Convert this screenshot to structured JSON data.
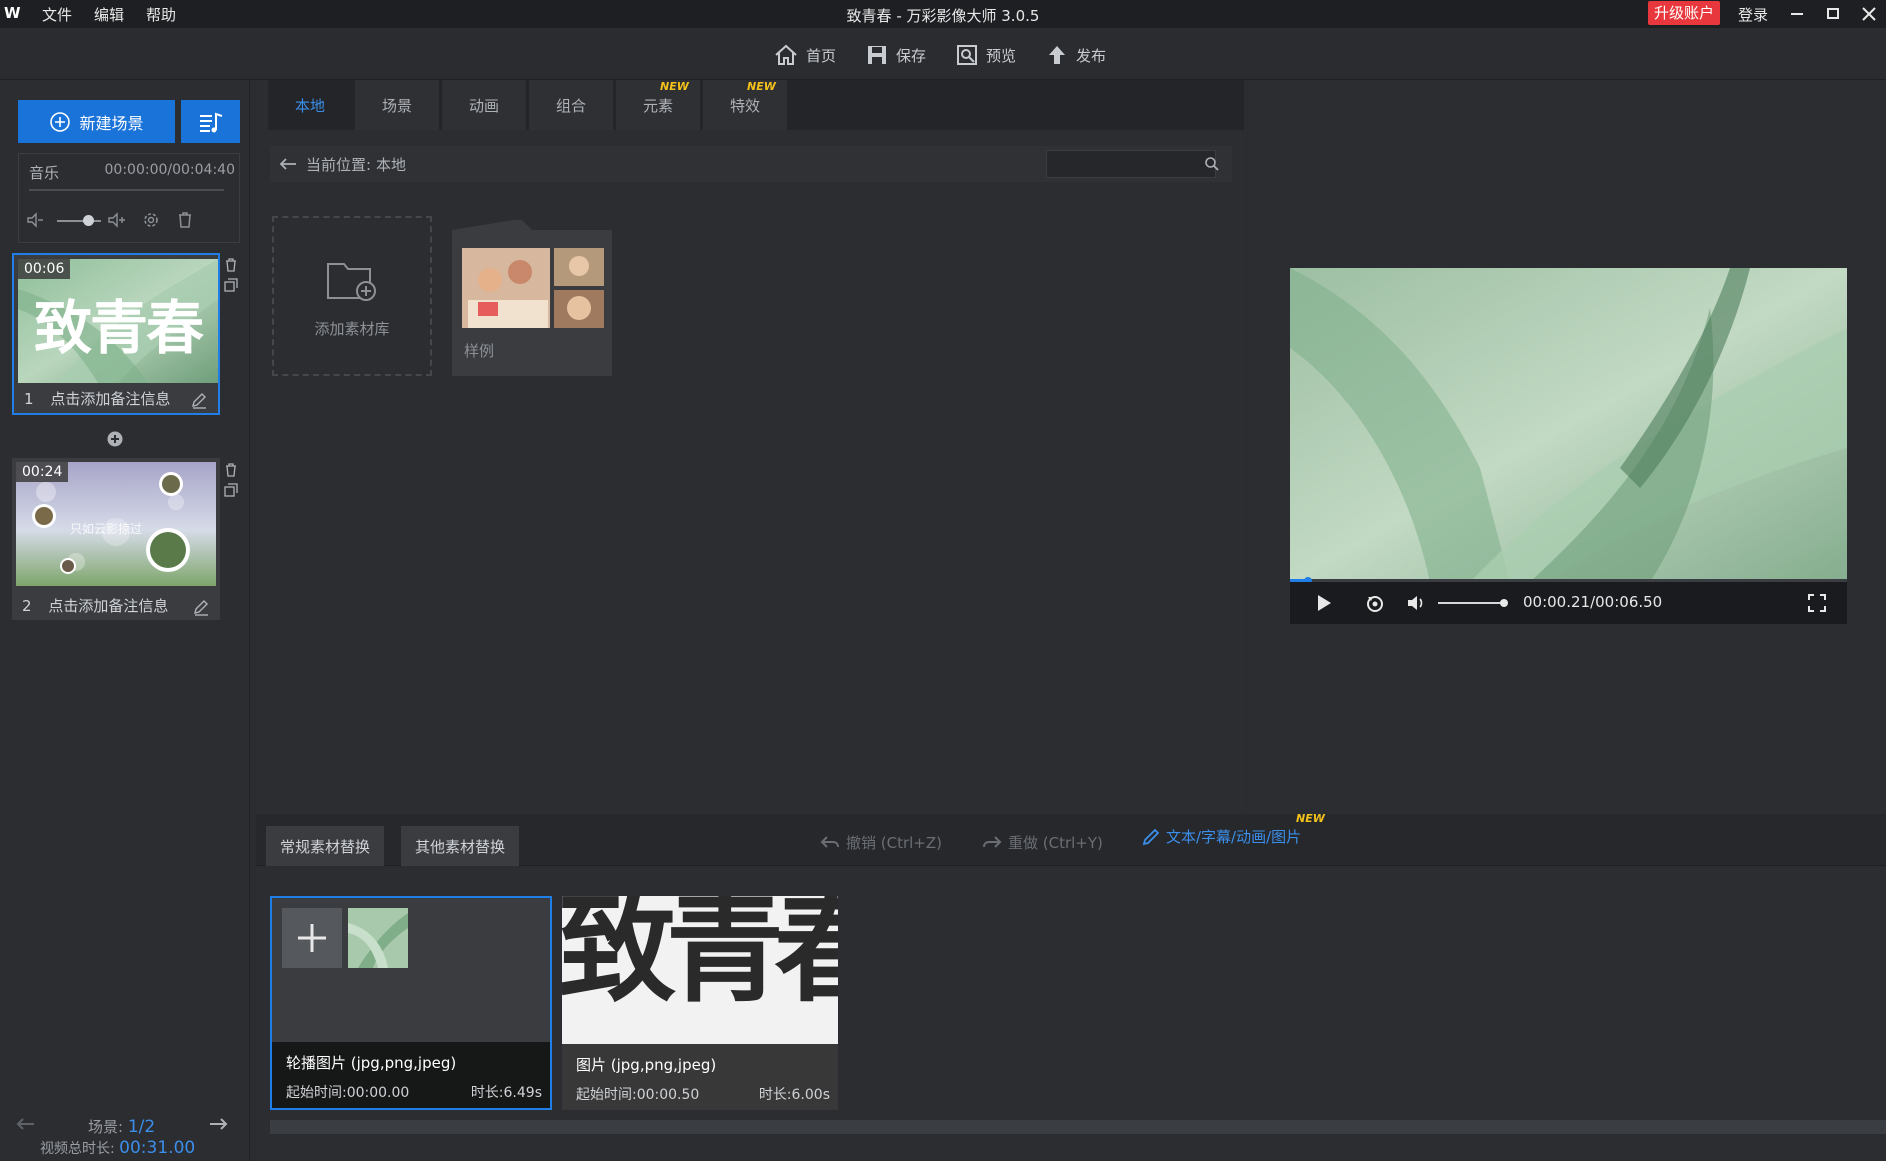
{
  "app": {
    "title": "致青春 - 万彩影像大师 3.0.5",
    "logo_text": "W",
    "menu": [
      "文件",
      "编辑",
      "帮助"
    ],
    "upgrade_label": "升级账户",
    "login_label": "登录"
  },
  "toolbar": {
    "home_label": "首页",
    "save_label": "保存",
    "preview_label": "预览",
    "publish_label": "发布"
  },
  "left": {
    "new_scene_label": "新建场景",
    "music_label": "音乐",
    "music_time": "00:00:00/00:04:40",
    "scenes": [
      {
        "index": "1",
        "duration": "00:06",
        "note": "点击添加备注信息",
        "thumb_text": "致青春"
      },
      {
        "index": "2",
        "duration": "00:24",
        "note": "点击添加备注信息",
        "thumb_text": "只如云影掠过"
      }
    ],
    "footer": {
      "scene_label": "场景:",
      "scene_value": "1/2",
      "total_label": "视频总时长:",
      "total_value": "00:31.00"
    }
  },
  "library": {
    "tabs": [
      {
        "label": "本地",
        "active": true,
        "new": false
      },
      {
        "label": "场景",
        "active": false,
        "new": false
      },
      {
        "label": "动画",
        "active": false,
        "new": false
      },
      {
        "label": "组合",
        "active": false,
        "new": false
      },
      {
        "label": "元素",
        "active": false,
        "new": true
      },
      {
        "label": "特效",
        "active": false,
        "new": true
      }
    ],
    "new_badge": "NEW",
    "location_label": "当前位置:",
    "location_value": "本地",
    "search_placeholder": "",
    "add_library_label": "添加素材库",
    "sample_label": "样例"
  },
  "preview": {
    "time": "00:00.21/00:06.50",
    "progress_fraction": 0.032,
    "volume_fraction": 1.0
  },
  "bottom": {
    "tabs": [
      "常规素材替换",
      "其他素材替换"
    ],
    "undo_label": "撤销 (Ctrl+Z)",
    "redo_label": "重做 (Ctrl+Y)",
    "text_link_label": "文本/字幕/动画/图片",
    "new_badge": "NEW",
    "assets": [
      {
        "title": "轮播图片 (jpg,png,jpeg)",
        "start": "起始时间:00:00.00",
        "duration": "时长:6.49s"
      },
      {
        "title": "图片 (jpg,png,jpeg)",
        "start": "起始时间:00:00.50",
        "duration": "时长:6.00s",
        "overlay_text": "致青春"
      }
    ]
  },
  "colors": {
    "accent": "#1a73d9",
    "active_tab_text": "#3b8eea",
    "upgrade": "#e8383d",
    "new_badge": "#f4c21a"
  }
}
